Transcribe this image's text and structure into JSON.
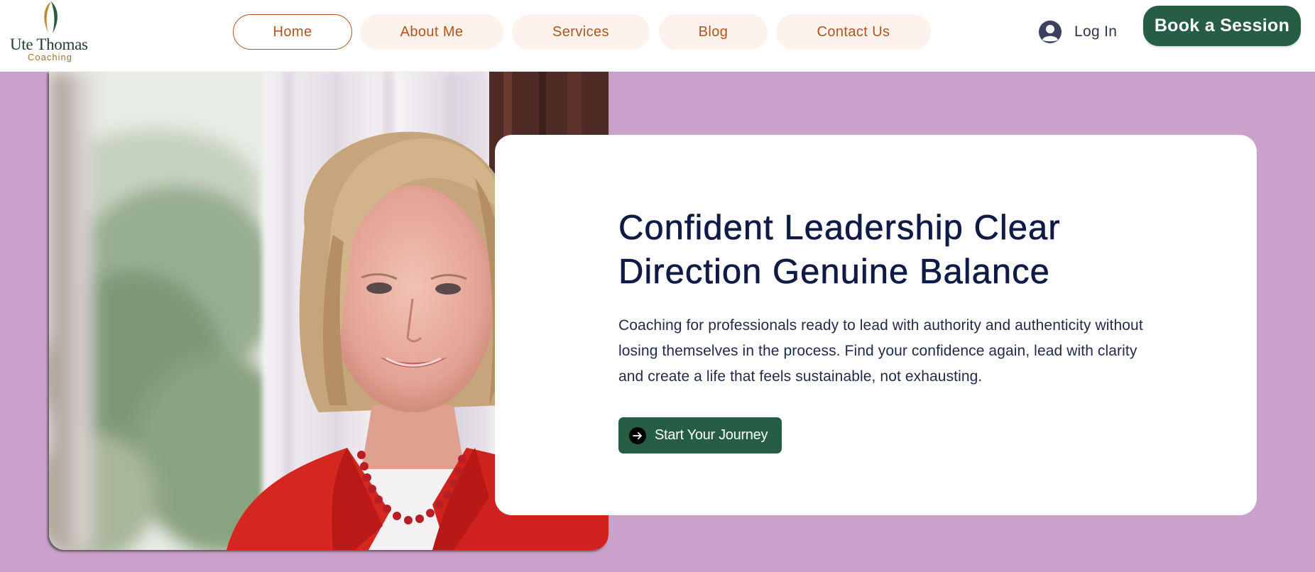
{
  "header": {
    "logo": {
      "name": "Ute Thomas",
      "subtitle": "Coaching"
    },
    "nav": [
      {
        "label": "Home",
        "active": true
      },
      {
        "label": "About Me",
        "active": false
      },
      {
        "label": "Services",
        "active": false
      },
      {
        "label": "Blog",
        "active": false
      },
      {
        "label": "Contact Us",
        "active": false
      }
    ],
    "login_label": "Log In",
    "book_label": "Book a Session"
  },
  "hero": {
    "title": "Confident Leadership Clear Direction Genuine Balance",
    "text": "Coaching for professionals ready to lead with authority and authenticity without losing themselves in the process. Find your confidence again, lead with clarity and create a life that feels sustainable, not exhausting.",
    "cta_label": "Start Your Journey",
    "cta_icon": "arrow-right-circle-icon",
    "photo": "portrait-photo"
  },
  "colors": {
    "page_background": "#c9a1ca",
    "primary_green": "#255e44",
    "nav_text": "#b3541e",
    "nav_pill_bg": "#fdf2ec",
    "heading": "#0f1a46"
  }
}
